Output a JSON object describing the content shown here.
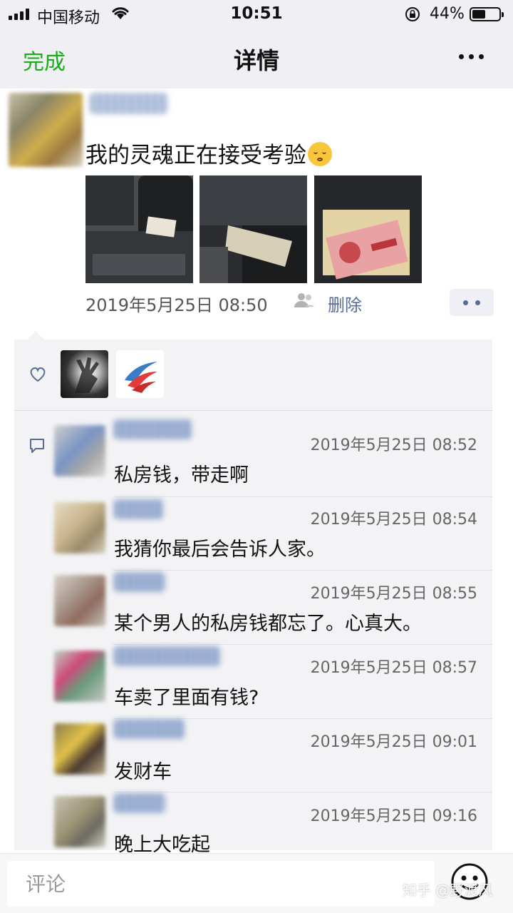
{
  "status_bar": {
    "carrier": "中国移动",
    "time": "10:51",
    "battery_percent": "44%",
    "battery_level": 0.44,
    "icons": [
      "signal-icon",
      "wifi-icon",
      "rotation-lock-icon",
      "battery-icon"
    ]
  },
  "nav": {
    "done_label": "完成",
    "title": "详情",
    "more_icon": "more-icon"
  },
  "post": {
    "text": "我的灵魂正在接受考验",
    "emoji": "face-emoji-icon",
    "photos": [
      "car-seat-photo",
      "envelope-under-seat-photo",
      "cash-box-photo"
    ],
    "timestamp": "2019年5月25日 08:50",
    "visibility_icon": "people-icon",
    "delete_label": "删除",
    "action_icon": "comment-action-icon"
  },
  "likes": {
    "icon": "heart-icon",
    "avatars": [
      "liker-avatar-hand",
      "liker-avatar-logo"
    ]
  },
  "comments": [
    {
      "time": "2019年5月25日 08:52",
      "text": "私房钱，带走啊"
    },
    {
      "time": "2019年5月25日 08:54",
      "text": "我猜你最后会告诉人家。"
    },
    {
      "time": "2019年5月25日 08:55",
      "text": "某个男人的私房钱都忘了。心真大。"
    },
    {
      "time": "2019年5月25日 08:57",
      "text": "车卖了里面有钱?"
    },
    {
      "time": "2019年5月25日 09:01",
      "text": "发财车"
    },
    {
      "time": "2019年5月25日 09:16",
      "text": "晚上大吃起"
    }
  ],
  "input": {
    "placeholder": "评论",
    "emoji_icon": "emoji-face-icon"
  },
  "watermark": "知乎 @野渡风",
  "colors": {
    "accent_green": "#1aad19",
    "link_blue": "#576b95",
    "header_bg": "#efeff4",
    "panel_bg": "#f3f3f5"
  }
}
